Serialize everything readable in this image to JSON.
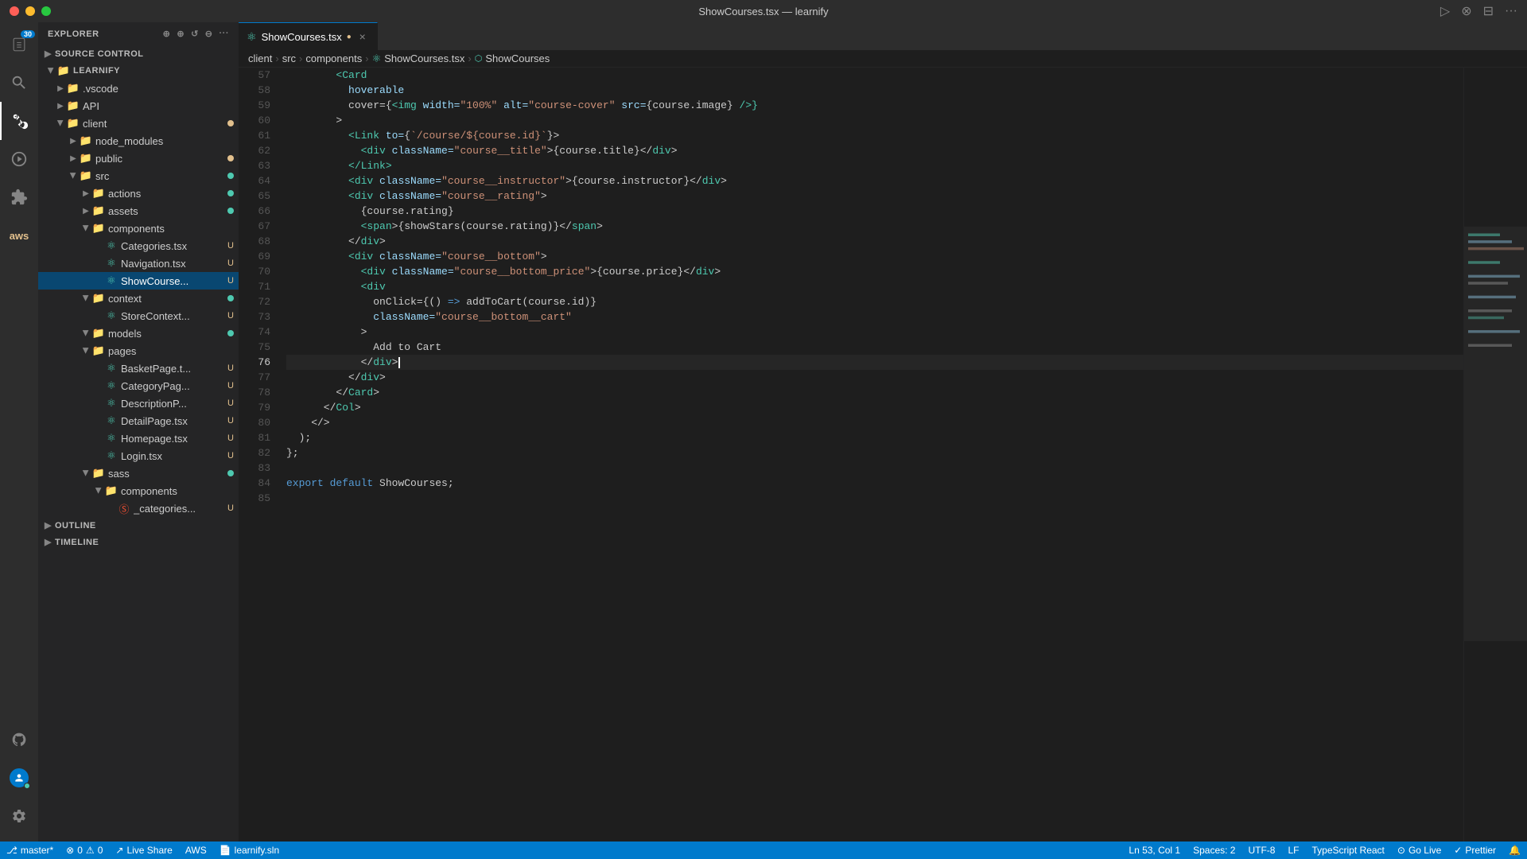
{
  "titlebar": {
    "title": "ShowCourses.tsx — learnify",
    "buttons": [
      "close",
      "minimize",
      "maximize"
    ]
  },
  "activity_bar": {
    "items": [
      {
        "name": "explorer",
        "icon": "📋",
        "badge": "30",
        "active": false
      },
      {
        "name": "search",
        "icon": "🔍",
        "active": false
      },
      {
        "name": "source-control",
        "icon": "⎇",
        "active": true
      },
      {
        "name": "run",
        "icon": "▷",
        "active": false
      },
      {
        "name": "extensions",
        "icon": "⊞",
        "active": false
      },
      {
        "name": "aws",
        "icon": "☁",
        "active": false
      }
    ],
    "bottom": [
      {
        "name": "github",
        "icon": "⊙"
      },
      {
        "name": "remote",
        "icon": "⊗"
      }
    ]
  },
  "sidebar": {
    "header": "Explorer",
    "source_control_label": "SOURCE CONTROL",
    "tree": {
      "root": "LEARNIFY",
      "items": [
        {
          "label": ".vscode",
          "type": "folder",
          "depth": 1,
          "icon": "folder",
          "color": "#e2c08d"
        },
        {
          "label": "API",
          "type": "folder",
          "depth": 1,
          "icon": "folder",
          "color": "#e2c08d"
        },
        {
          "label": "client",
          "type": "folder",
          "depth": 1,
          "icon": "folder",
          "color": "#e2c08d",
          "dot": "modified",
          "open": true
        },
        {
          "label": "node_modules",
          "type": "folder",
          "depth": 2,
          "icon": "folder-modules",
          "color": "#e2c08d"
        },
        {
          "label": "public",
          "type": "folder",
          "depth": 2,
          "icon": "folder-public",
          "color": "#e2c08d",
          "dot": "modified"
        },
        {
          "label": "src",
          "type": "folder",
          "depth": 2,
          "icon": "folder-src",
          "color": "#4ec9b0",
          "dot": "added",
          "open": true
        },
        {
          "label": "actions",
          "type": "folder",
          "depth": 3,
          "icon": "folder",
          "color": "#e2c08d",
          "dot": "added"
        },
        {
          "label": "assets",
          "type": "folder",
          "depth": 3,
          "icon": "folder",
          "color": "#e2c08d",
          "dot": "added"
        },
        {
          "label": "components",
          "type": "folder",
          "depth": 3,
          "icon": "folder",
          "color": "#e2c08d",
          "open": true
        },
        {
          "label": "Categories.tsx",
          "type": "file",
          "depth": 4,
          "icon": "tsx",
          "badge": "U"
        },
        {
          "label": "Navigation.tsx",
          "type": "file",
          "depth": 4,
          "icon": "tsx",
          "badge": "U"
        },
        {
          "label": "ShowCourse...",
          "type": "file",
          "depth": 4,
          "icon": "tsx",
          "badge": "U",
          "active": true
        },
        {
          "label": "context",
          "type": "folder",
          "depth": 3,
          "icon": "folder",
          "color": "#e2c08d",
          "dot": "added",
          "open": true
        },
        {
          "label": "StoreContext...",
          "type": "file",
          "depth": 4,
          "icon": "tsx",
          "badge": "U"
        },
        {
          "label": "models",
          "type": "folder",
          "depth": 3,
          "icon": "folder",
          "color": "#e2c08d",
          "dot": "added",
          "open": true
        },
        {
          "label": "pages",
          "type": "folder",
          "depth": 3,
          "icon": "folder",
          "color": "#e2c08d",
          "open": true
        },
        {
          "label": "BasketPage.t...",
          "type": "file",
          "depth": 4,
          "icon": "tsx",
          "badge": "U"
        },
        {
          "label": "CategoryPag...",
          "type": "file",
          "depth": 4,
          "icon": "tsx",
          "badge": "U"
        },
        {
          "label": "DescriptionP...",
          "type": "file",
          "depth": 4,
          "icon": "tsx",
          "badge": "U"
        },
        {
          "label": "DetailPage.tsx",
          "type": "file",
          "depth": 4,
          "icon": "tsx",
          "badge": "U"
        },
        {
          "label": "Homepage.tsx",
          "type": "file",
          "depth": 4,
          "icon": "tsx",
          "badge": "U"
        },
        {
          "label": "Login.tsx",
          "type": "file",
          "depth": 4,
          "icon": "tsx",
          "badge": "U"
        },
        {
          "label": "sass",
          "type": "folder",
          "depth": 3,
          "icon": "folder",
          "color": "#f14e32",
          "dot": "added",
          "open": true
        },
        {
          "label": "components",
          "type": "folder",
          "depth": 4,
          "icon": "folder",
          "color": "#e2c08d",
          "open": true
        },
        {
          "label": "_categories...",
          "type": "file",
          "depth": 5,
          "icon": "scss",
          "badge": "U"
        }
      ]
    },
    "outline_label": "OUTLINE",
    "timeline_label": "TIMELINE"
  },
  "tabs": [
    {
      "label": "ShowCourses.tsx",
      "icon": "tsx",
      "modified": true,
      "active": true,
      "closeable": true
    }
  ],
  "breadcrumb": {
    "items": [
      "client",
      "src",
      "components",
      "ShowCourses.tsx",
      "ShowCourses"
    ]
  },
  "editor": {
    "lines": [
      {
        "num": 57,
        "tokens": [
          {
            "text": "        ",
            "class": ""
          },
          {
            "text": "<Card",
            "class": "c-tag"
          }
        ]
      },
      {
        "num": 58,
        "tokens": [
          {
            "text": "          hoverable",
            "class": "c-attr"
          }
        ]
      },
      {
        "num": 59,
        "tokens": [
          {
            "text": "          cover={",
            "class": "c-punct"
          },
          {
            "text": "<img",
            "class": "c-tag"
          },
          {
            "text": " width=",
            "class": "c-attr"
          },
          {
            "text": "\"100%\"",
            "class": "c-str"
          },
          {
            "text": " alt=",
            "class": "c-attr"
          },
          {
            "text": "\"course-cover\"",
            "class": "c-str"
          },
          {
            "text": " src={course.image}",
            "class": "c-punct"
          },
          {
            "text": " />}",
            "class": "c-tag"
          }
        ]
      },
      {
        "num": 60,
        "tokens": [
          {
            "text": "        >",
            "class": "c-punct"
          }
        ]
      },
      {
        "num": 61,
        "tokens": [
          {
            "text": "          ",
            "class": ""
          },
          {
            "text": "<Link",
            "class": "c-tag"
          },
          {
            "text": " to={`/course/${course.id}`}>",
            "class": "c-str"
          }
        ]
      },
      {
        "num": 62,
        "tokens": [
          {
            "text": "            ",
            "class": ""
          },
          {
            "text": "<div",
            "class": "c-tag"
          },
          {
            "text": " className=",
            "class": "c-attr"
          },
          {
            "text": "\"course__title\"",
            "class": "c-str"
          },
          {
            "text": ">{course.title}</",
            "class": "c-punct"
          },
          {
            "text": "div",
            "class": "c-tag"
          },
          {
            "text": ">",
            "class": "c-punct"
          }
        ]
      },
      {
        "num": 63,
        "tokens": [
          {
            "text": "          ",
            "class": ""
          },
          {
            "text": "</Link>",
            "class": "c-tag"
          }
        ]
      },
      {
        "num": 64,
        "tokens": [
          {
            "text": "          ",
            "class": ""
          },
          {
            "text": "<div",
            "class": "c-tag"
          },
          {
            "text": " className=",
            "class": "c-attr"
          },
          {
            "text": "\"course__instructor\"",
            "class": "c-str"
          },
          {
            "text": ">{course.instructor}</",
            "class": "c-punct"
          },
          {
            "text": "div",
            "class": "c-tag"
          },
          {
            "text": ">",
            "class": "c-punct"
          }
        ]
      },
      {
        "num": 65,
        "tokens": [
          {
            "text": "          ",
            "class": ""
          },
          {
            "text": "<div",
            "class": "c-tag"
          },
          {
            "text": " className=",
            "class": "c-attr"
          },
          {
            "text": "\"course__rating\"",
            "class": "c-str"
          },
          {
            "text": ">",
            "class": "c-punct"
          }
        ]
      },
      {
        "num": 66,
        "tokens": [
          {
            "text": "            {course.rating}",
            "class": "c-text"
          }
        ]
      },
      {
        "num": 67,
        "tokens": [
          {
            "text": "            ",
            "class": ""
          },
          {
            "text": "<span",
            "class": "c-tag"
          },
          {
            "text": ">{showStars(course.rating)}</",
            "class": "c-text"
          },
          {
            "text": "span",
            "class": "c-tag"
          },
          {
            "text": ">",
            "class": "c-punct"
          }
        ]
      },
      {
        "num": 68,
        "tokens": [
          {
            "text": "          </",
            "class": "c-punct"
          },
          {
            "text": "div",
            "class": "c-tag"
          },
          {
            "text": ">",
            "class": "c-punct"
          }
        ]
      },
      {
        "num": 69,
        "tokens": [
          {
            "text": "          ",
            "class": ""
          },
          {
            "text": "<div",
            "class": "c-tag"
          },
          {
            "text": " className=",
            "class": "c-attr"
          },
          {
            "text": "\"course__bottom\"",
            "class": "c-str"
          },
          {
            "text": ">",
            "class": "c-punct"
          }
        ]
      },
      {
        "num": 70,
        "tokens": [
          {
            "text": "            ",
            "class": ""
          },
          {
            "text": "<div",
            "class": "c-tag"
          },
          {
            "text": " className=",
            "class": "c-attr"
          },
          {
            "text": "\"course__bottom_price\"",
            "class": "c-str"
          },
          {
            "text": ">{course.price}</",
            "class": "c-punct"
          },
          {
            "text": "div",
            "class": "c-tag"
          },
          {
            "text": ">",
            "class": "c-punct"
          }
        ]
      },
      {
        "num": 71,
        "tokens": [
          {
            "text": "            ",
            "class": ""
          },
          {
            "text": "<div",
            "class": "c-tag"
          }
        ]
      },
      {
        "num": 72,
        "tokens": [
          {
            "text": "              onClick={() => addToCart(course.id)}",
            "class": "c-text"
          }
        ]
      },
      {
        "num": 73,
        "tokens": [
          {
            "text": "              className=",
            "class": "c-attr"
          },
          {
            "text": "\"course__bottom__cart\"",
            "class": "c-str"
          }
        ]
      },
      {
        "num": 74,
        "tokens": [
          {
            "text": "            >",
            "class": "c-punct"
          }
        ]
      },
      {
        "num": 75,
        "tokens": [
          {
            "text": "              Add to Cart",
            "class": "c-text"
          }
        ]
      },
      {
        "num": 76,
        "tokens": [
          {
            "text": "            </",
            "class": "c-punct"
          },
          {
            "text": "div",
            "class": "c-tag"
          },
          {
            "text": ">",
            "class": "c-punct"
          }
        ]
      },
      {
        "num": 77,
        "tokens": [
          {
            "text": "          </",
            "class": "c-punct"
          },
          {
            "text": "div",
            "class": "c-tag"
          },
          {
            "text": ">",
            "class": "c-punct"
          }
        ]
      },
      {
        "num": 78,
        "tokens": [
          {
            "text": "        </",
            "class": "c-punct"
          },
          {
            "text": "Card",
            "class": "c-tag"
          },
          {
            "text": ">",
            "class": "c-punct"
          }
        ]
      },
      {
        "num": 79,
        "tokens": [
          {
            "text": "      </",
            "class": "c-punct"
          },
          {
            "text": "Col",
            "class": "c-tag"
          },
          {
            "text": ">",
            "class": "c-punct"
          }
        ]
      },
      {
        "num": 80,
        "tokens": [
          {
            "text": "    </>",
            "class": "c-punct"
          }
        ]
      },
      {
        "num": 81,
        "tokens": [
          {
            "text": "  );",
            "class": "c-punct"
          }
        ]
      },
      {
        "num": 82,
        "tokens": [
          {
            "text": "};",
            "class": "c-punct"
          }
        ]
      },
      {
        "num": 83,
        "tokens": []
      },
      {
        "num": 84,
        "tokens": [
          {
            "text": "export",
            "class": "c-kw"
          },
          {
            "text": " ",
            "class": ""
          },
          {
            "text": "default",
            "class": "c-kw"
          },
          {
            "text": " ShowCourses;",
            "class": "c-text"
          }
        ]
      },
      {
        "num": 85,
        "tokens": []
      }
    ],
    "cursor_line": 76,
    "cursor_col": "Ln 53, Col 1"
  },
  "status_bar": {
    "branch": "master*",
    "errors": "0",
    "warnings": "0",
    "live_share": "Live Share",
    "aws": "AWS",
    "solution": "learnify.sln",
    "line_col": "Ln 53, Col 1",
    "spaces": "Spaces: 2",
    "encoding": "UTF-8",
    "line_ending": "LF",
    "language": "TypeScript React",
    "go_live": "Go Live",
    "prettier": "Prettier"
  }
}
